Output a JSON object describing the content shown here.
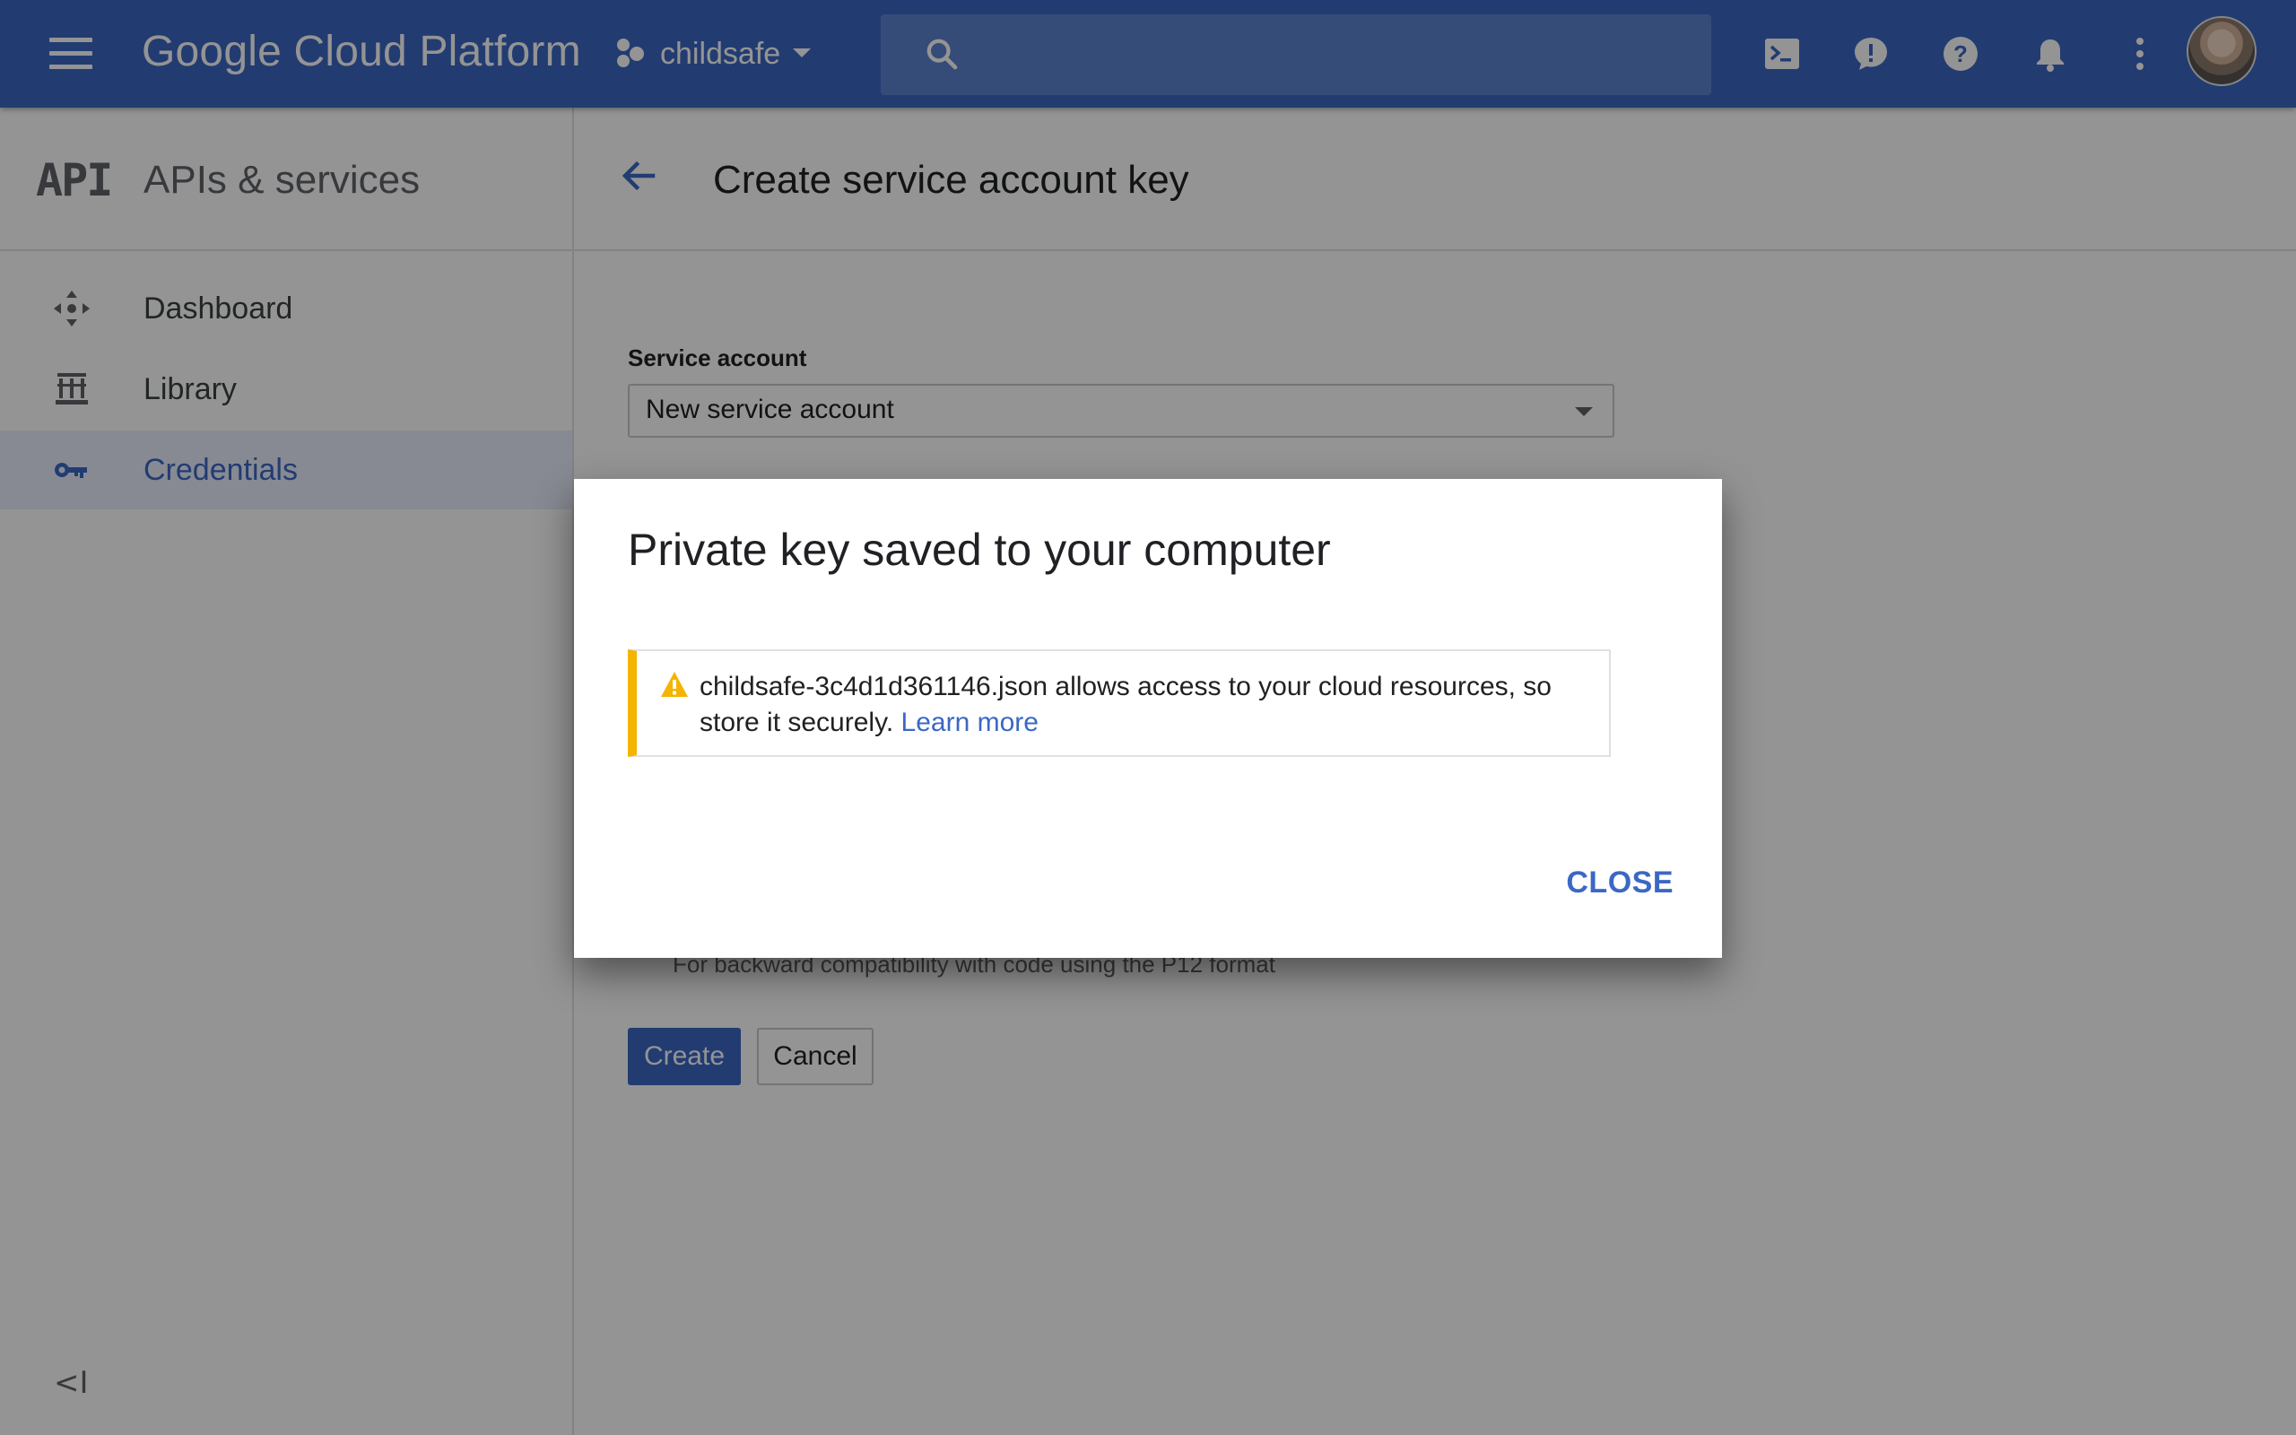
{
  "header": {
    "product_name": "Google Cloud Platform",
    "project_name": "childsafe",
    "search_placeholder": ""
  },
  "sidebar": {
    "logo_text": "API",
    "title": "APIs & services",
    "items": [
      {
        "label": "Dashboard",
        "icon": "dashboard-icon",
        "active": false
      },
      {
        "label": "Library",
        "icon": "library-icon",
        "active": false
      },
      {
        "label": "Credentials",
        "icon": "key-icon",
        "active": true
      }
    ],
    "collapse_glyph": "<I"
  },
  "main": {
    "title": "Create service account key",
    "service_account_label": "Service account",
    "service_account_value": "New service account",
    "p12_note": "For backward compatibility with code using the P12 format",
    "create_label": "Create",
    "cancel_label": "Cancel"
  },
  "dialog": {
    "title": "Private key saved to your computer",
    "message": "childsafe-3c4d1d361146.json allows access to your cloud resources, so store it securely.",
    "link_label": "Learn more",
    "close_label": "CLOSE"
  },
  "colors": {
    "header_blue": "#3b68c4",
    "accent": "#3b68c4",
    "warning": "#f4b400"
  }
}
